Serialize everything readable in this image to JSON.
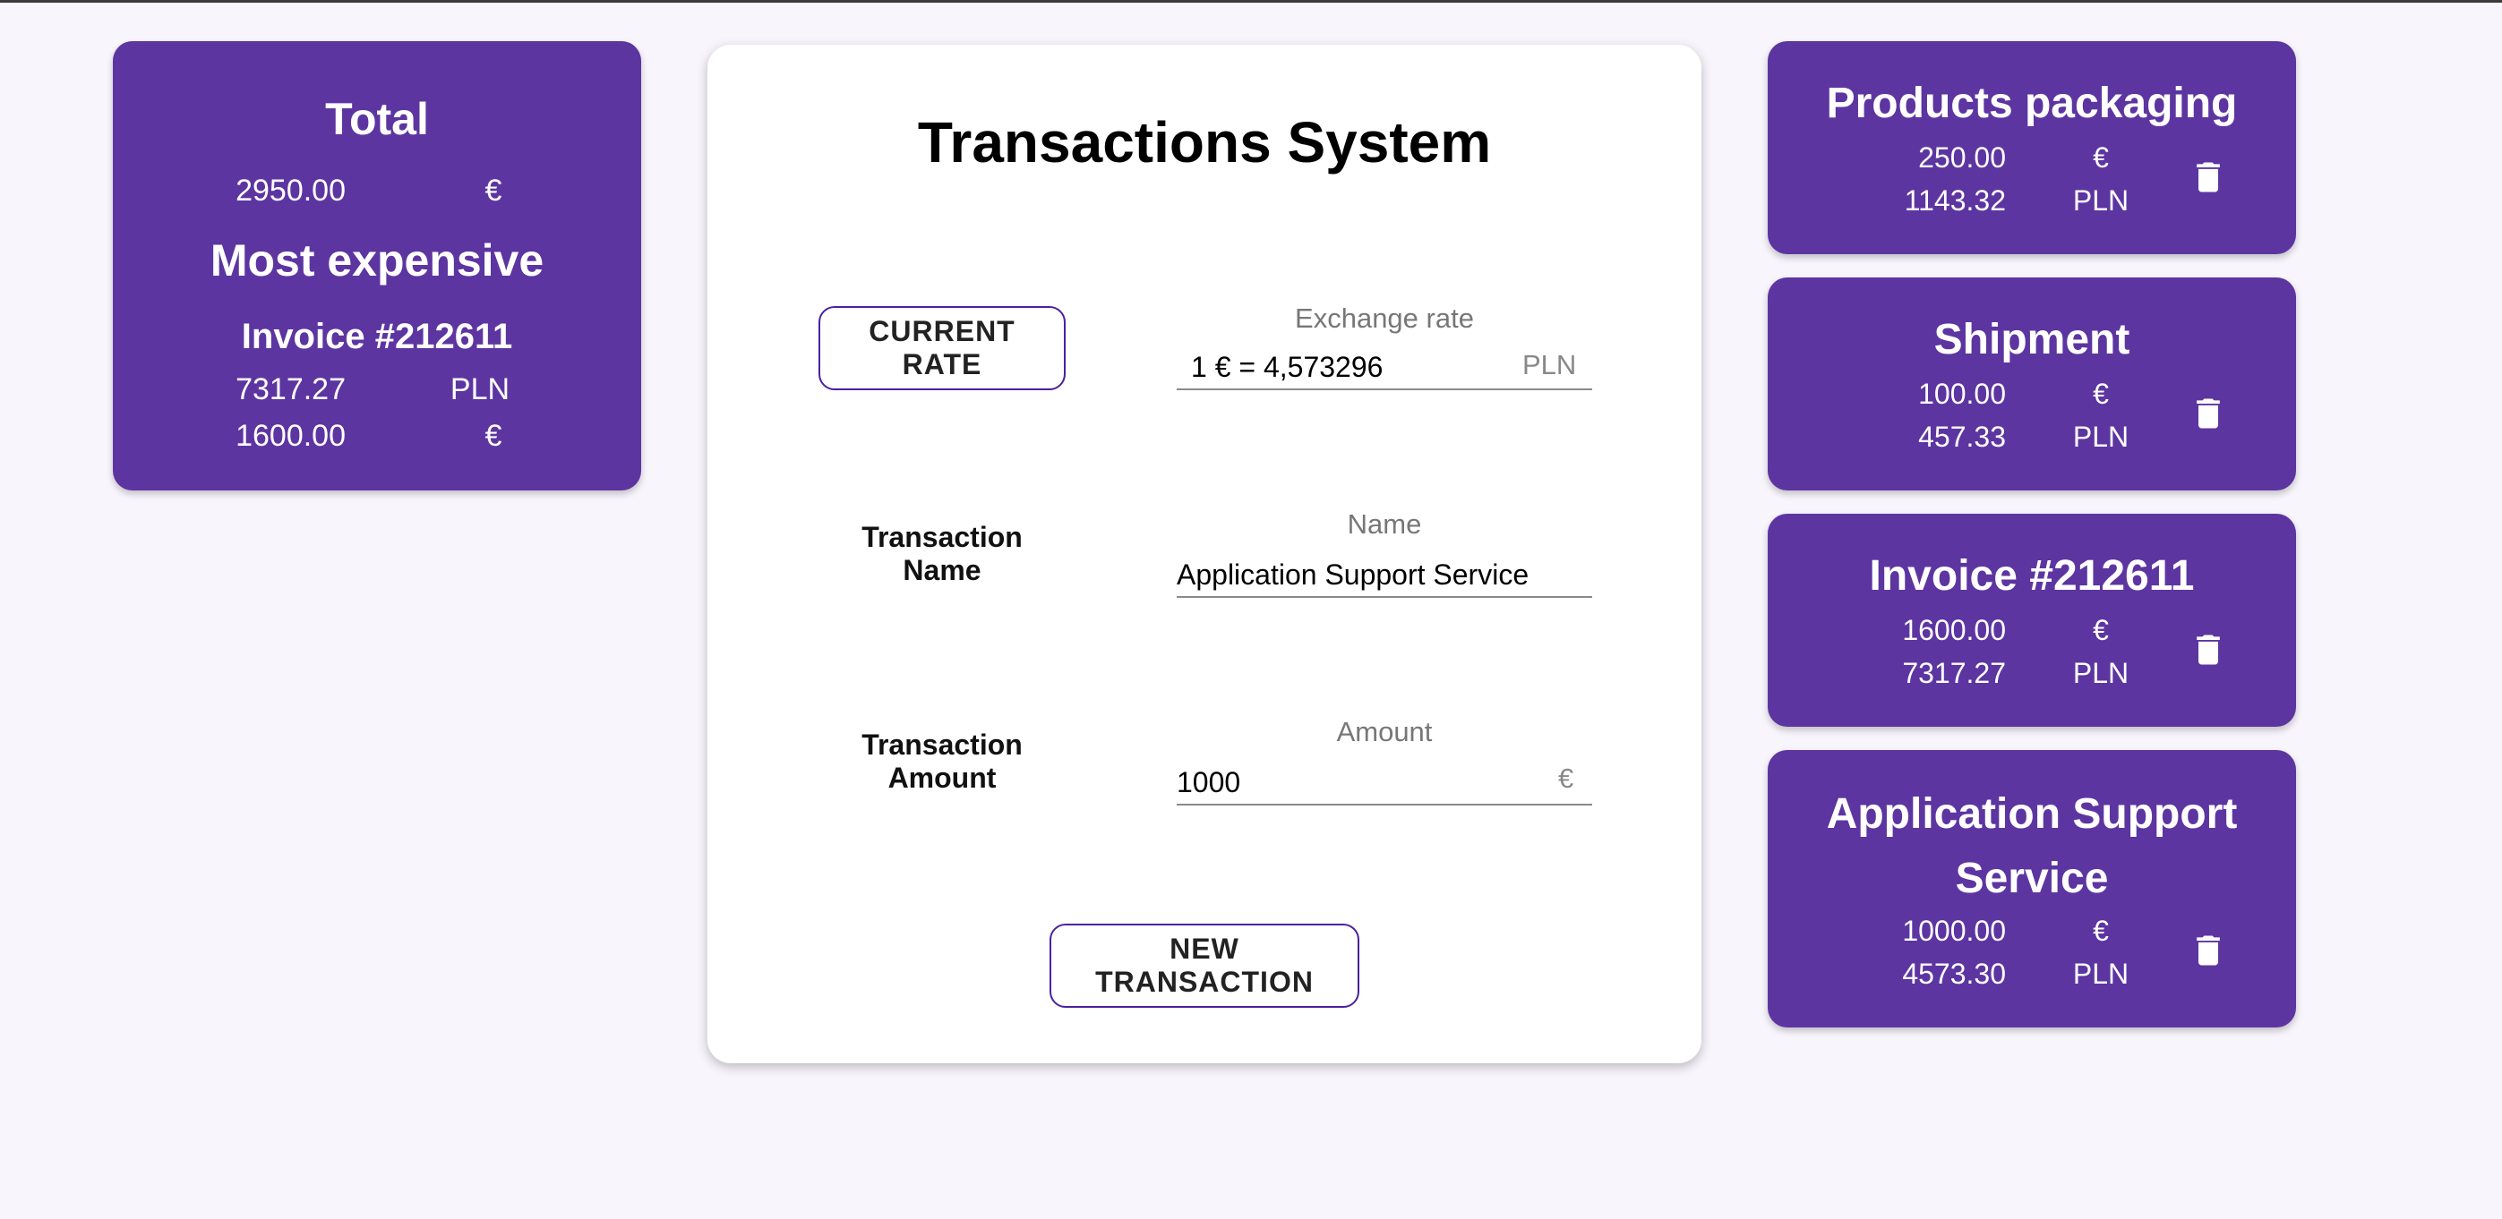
{
  "summary": {
    "total_title": "Total",
    "total_amount": "2950.00",
    "total_currency": "€",
    "most_expensive_title": "Most expensive",
    "most_expensive_name": "Invoice #212611",
    "most_expensive_pln_amount": "7317.27",
    "most_expensive_pln_currency": "PLN",
    "most_expensive_eur_amount": "1600.00",
    "most_expensive_eur_currency": "€"
  },
  "form": {
    "title": "Transactions System",
    "current_rate_button": "CURRENT RATE",
    "exchange_rate_caption": "Exchange rate",
    "exchange_rate_value": "1 € = 4,573296",
    "exchange_rate_suffix": "PLN",
    "name_label_line1": "Transaction",
    "name_label_line2": "Name",
    "name_caption": "Name",
    "name_value": "Application Support Service",
    "amount_label_line1": "Transaction",
    "amount_label_line2": "Amount",
    "amount_caption": "Amount",
    "amount_value": "1000",
    "amount_suffix": "€",
    "new_transaction_button": "NEW TRANSACTION"
  },
  "transactions": [
    {
      "name": "Products packaging",
      "eur_amount": "250.00",
      "eur_currency": "€",
      "pln_amount": "1143.32",
      "pln_currency": "PLN"
    },
    {
      "name": "Shipment",
      "eur_amount": "100.00",
      "eur_currency": "€",
      "pln_amount": "457.33",
      "pln_currency": "PLN"
    },
    {
      "name": "Invoice #212611",
      "eur_amount": "1600.00",
      "eur_currency": "€",
      "pln_amount": "7317.27",
      "pln_currency": "PLN"
    },
    {
      "name": "Application Support Service",
      "eur_amount": "1000.00",
      "eur_currency": "€",
      "pln_amount": "4573.30",
      "pln_currency": "PLN"
    }
  ],
  "icons": {
    "delete": "trash-icon"
  },
  "colors": {
    "card_purple": "#5d35a1",
    "button_border": "#4a21a0",
    "background": "#f8f5fc"
  }
}
